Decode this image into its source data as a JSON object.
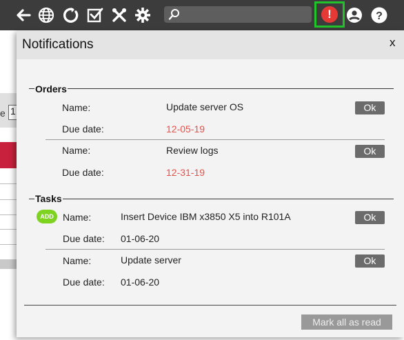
{
  "toolbar": {
    "icons": [
      "back-arrow-icon",
      "globe-icon",
      "refresh-icon",
      "checkbox-icon",
      "tools-icon",
      "gear-icon"
    ],
    "search_value": "",
    "alert_symbol": "!",
    "alert_color": "#e53935",
    "highlight_color": "#22c22a"
  },
  "background": {
    "label": "e",
    "input_value": "1"
  },
  "panel": {
    "title": "Notifications",
    "close": "x",
    "orders": {
      "title": "Orders",
      "items": [
        {
          "name_label": "Name:",
          "name": "Update server OS",
          "due_label": "Due date:",
          "due": "12-05-19",
          "ok": "Ok"
        },
        {
          "name_label": "Name:",
          "name": "Review logs",
          "due_label": "Due date:",
          "due": "12-31-19",
          "ok": "Ok"
        }
      ]
    },
    "tasks": {
      "title": "Tasks",
      "items": [
        {
          "badge": "ADD",
          "name_label": "Name:",
          "name": "Insert Device IBM x3850 X5 into R101A",
          "due_label": "Due date:",
          "due": "01-06-20",
          "ok": "Ok"
        },
        {
          "name_label": "Name:",
          "name": "Update server",
          "due_label": "Due date:",
          "due": "01-06-20",
          "ok": "Ok"
        }
      ]
    },
    "mark_all_label": "Mark all as read"
  }
}
